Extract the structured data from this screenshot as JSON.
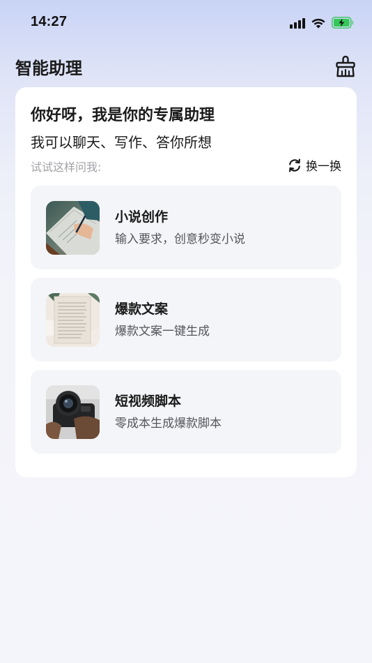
{
  "status_bar": {
    "time": "14:27",
    "icons": [
      "signal-icon",
      "wifi-icon",
      "battery-charging-icon"
    ]
  },
  "header": {
    "title": "智能助理",
    "clean_icon": "broom-icon"
  },
  "assistant": {
    "greeting": "你好呀，我是你的专属助理",
    "subtitle": "我可以聊天、写作、答你所想",
    "hint": "试试这样问我:",
    "refresh_label": "换一换"
  },
  "suggestions": [
    {
      "title": "小说创作",
      "desc": "输入要求，创意秒变小说",
      "icon": "writing-photo"
    },
    {
      "title": "爆款文案",
      "desc": "爆款文案一键生成",
      "icon": "notepaper-photo"
    },
    {
      "title": "短视频脚本",
      "desc": "零成本生成爆款脚本",
      "icon": "camera-photo"
    }
  ],
  "colors": {
    "accent_battery": "#34c759",
    "card_bg": "#ffffff",
    "item_bg": "#f4f5f8"
  }
}
